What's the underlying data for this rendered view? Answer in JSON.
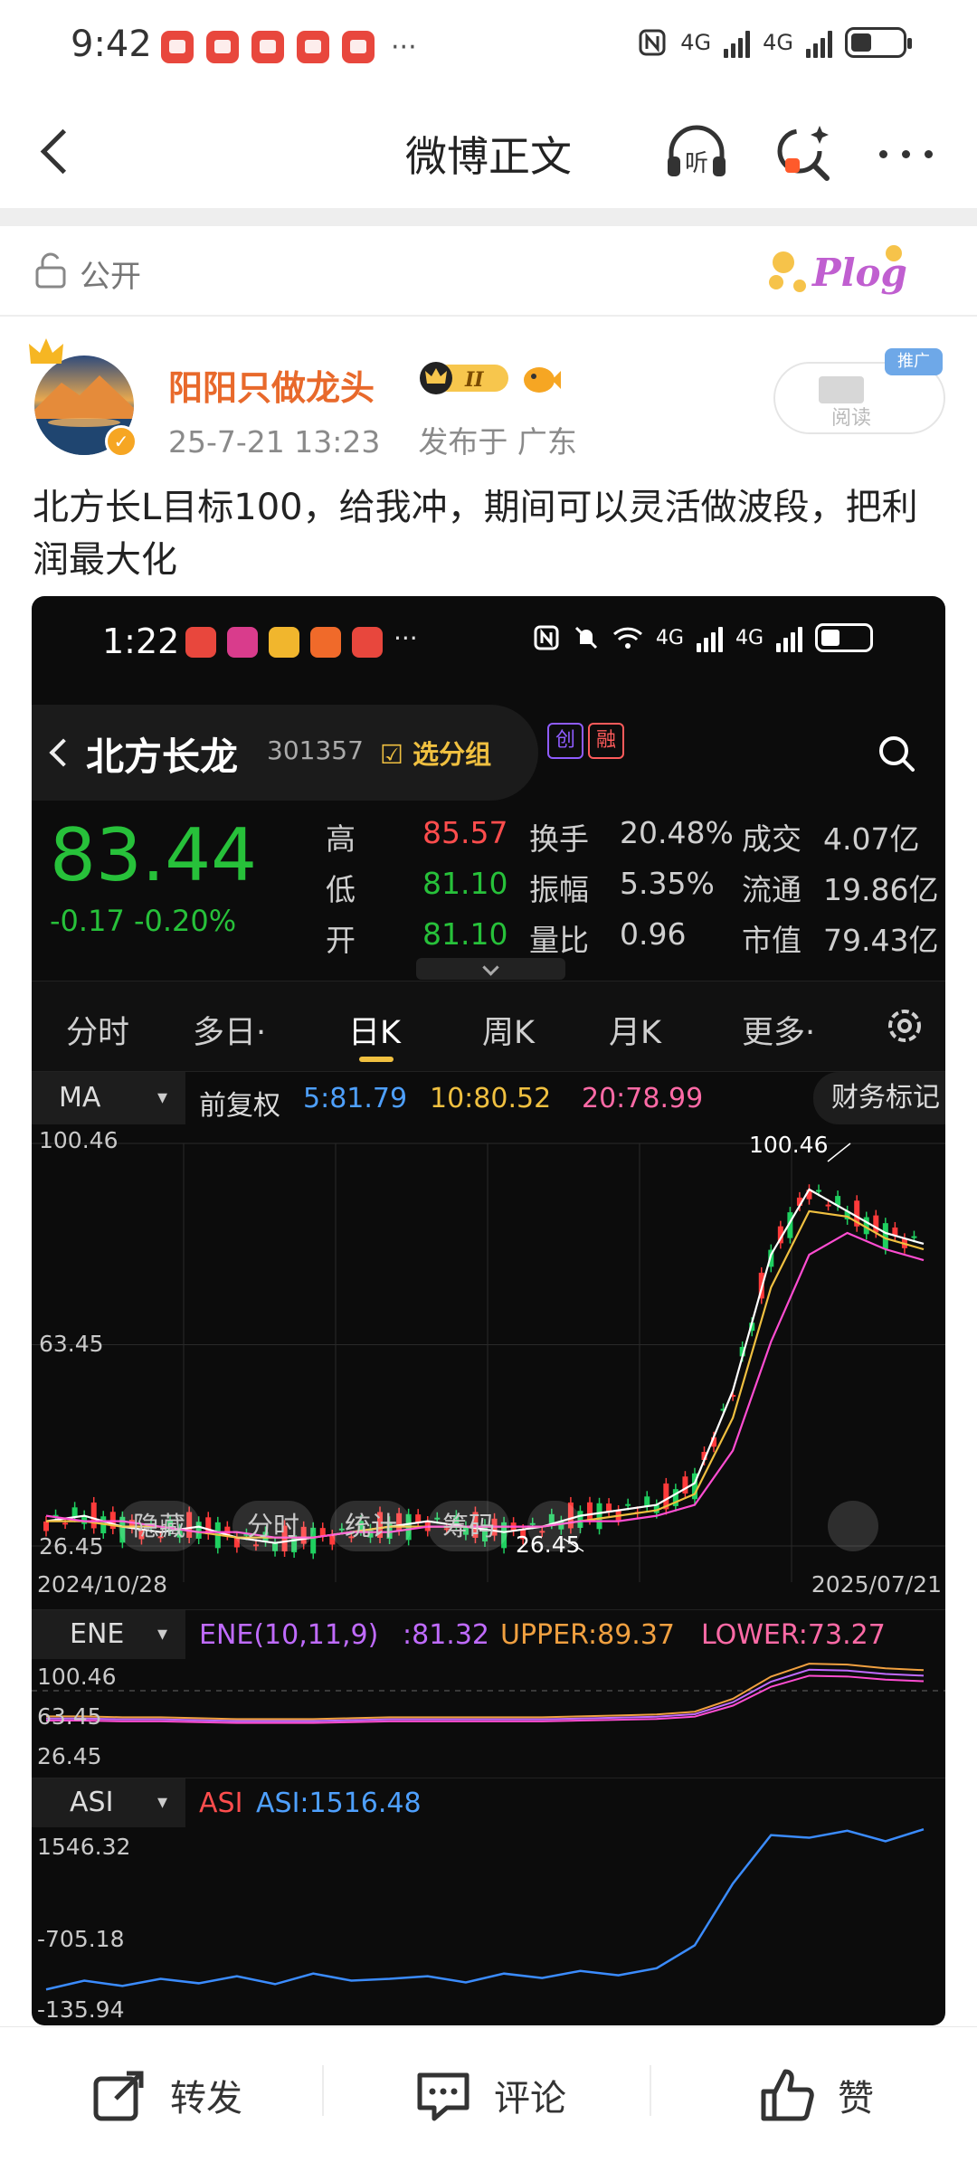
{
  "status_bar": {
    "time": "9:42",
    "overflow_dots": "···",
    "network1": "4G",
    "network2": "4G"
  },
  "nav": {
    "title": "微博正文",
    "listen_icon": "headphones-icon",
    "listen_label": "听",
    "scan_icon": "scan-icon",
    "more_icon": "more-icon"
  },
  "visibility": {
    "label": "公开",
    "icon": "lock-icon",
    "sticker_text": "Plog"
  },
  "author": {
    "name": "阳阳只做龙头",
    "rank_badge": "II",
    "time": "25-7-21 13:23",
    "location": "发布于 广东",
    "reads_label": "阅读",
    "reads_tag": "推广"
  },
  "post": {
    "text": "北方长L目标100，给我冲，期间可以灵活做波段，把利润最大化"
  },
  "screenshot": {
    "status": {
      "time": "1:22",
      "overflow_dots": "···",
      "network1": "4G",
      "network2": "4G"
    },
    "header": {
      "name": "北方长龙",
      "code": "301357",
      "group_label": "选分组",
      "tag1": "创",
      "tag2": "融"
    },
    "price": {
      "current": "83.44",
      "change": "-0.17 -0.20%"
    },
    "quote": [
      {
        "label": "高",
        "value": "85.57",
        "label2": "换手",
        "value2": "20.48%",
        "label3": "成交",
        "value3": "4.07亿"
      },
      {
        "label": "低",
        "value": "81.10",
        "label2": "振幅",
        "value2": "5.35%",
        "label3": "流通",
        "value3": "19.86亿"
      },
      {
        "label": "开",
        "value": "81.10",
        "label2": "量比",
        "value2": "0.96",
        "label3": "市值",
        "value3": "79.43亿"
      }
    ],
    "tabs": [
      "分时",
      "多日·",
      "日K",
      "周K",
      "月K",
      "更多·"
    ],
    "ma": {
      "selector": "MA",
      "adjust": "前复权",
      "ma5": "5:81.79",
      "ma10": "10:80.52",
      "ma20": "20:78.99",
      "fin_mark": "财务标记"
    },
    "kline": {
      "y_top": "100.46",
      "y_mid": "63.45",
      "y_bottom": "26.45",
      "high_label": "100.46",
      "low_label": "26.45",
      "date_start": "2024/10/28",
      "date_end": "2025/07/21",
      "pills": [
        "隐藏",
        "分时",
        "统计",
        "筹码"
      ]
    },
    "ene": {
      "selector": "ENE",
      "title": "ENE(10,11,9)",
      "value": ":81.32",
      "upper": "UPPER:89.37",
      "lower": "LOWER:73.27",
      "y_top": "100.46",
      "y_mid": "63.45",
      "y_bottom": "26.45"
    },
    "asi": {
      "selector": "ASI",
      "name": "ASI",
      "value": "ASI:1516.48",
      "y_top": "1546.32",
      "y_mid": "-705.18",
      "y_bottom": "-135.94"
    }
  },
  "chart_data": {
    "type": "line",
    "title": "北方长龙 301357 日K",
    "x_start": "2024/10/28",
    "x_end": "2025/07/21",
    "ylim": [
      26.45,
      100.46
    ],
    "series": [
      {
        "name": "MA5",
        "values": [
          31,
          32,
          30,
          29,
          30,
          28,
          27,
          28,
          29,
          30,
          31,
          30,
          29,
          30,
          32,
          33,
          34,
          38,
          55,
          80,
          92,
          88,
          84,
          82
        ]
      },
      {
        "name": "MA10",
        "values": [
          31,
          31,
          30,
          30,
          29,
          28,
          28,
          28,
          29,
          30,
          30,
          30,
          30,
          30,
          31,
          32,
          33,
          36,
          50,
          74,
          88,
          87,
          83,
          81
        ]
      },
      {
        "name": "MA20",
        "values": [
          32,
          31,
          31,
          30,
          29,
          29,
          28,
          28,
          29,
          29,
          30,
          30,
          30,
          30,
          31,
          31,
          32,
          34,
          44,
          64,
          80,
          84,
          81,
          79
        ]
      }
    ],
    "annotations": [
      "100.46",
      "26.45"
    ]
  },
  "bottom_bar": {
    "repost": "转发",
    "comment": "评论",
    "like": "赞"
  },
  "colors": {
    "accent_orange": "#e8692b",
    "stock_green": "#27c13a",
    "stock_red": "#ff4d4d",
    "ma5": "#ffffff",
    "ma10": "#f0c040",
    "ma20": "#ff4dd2"
  }
}
